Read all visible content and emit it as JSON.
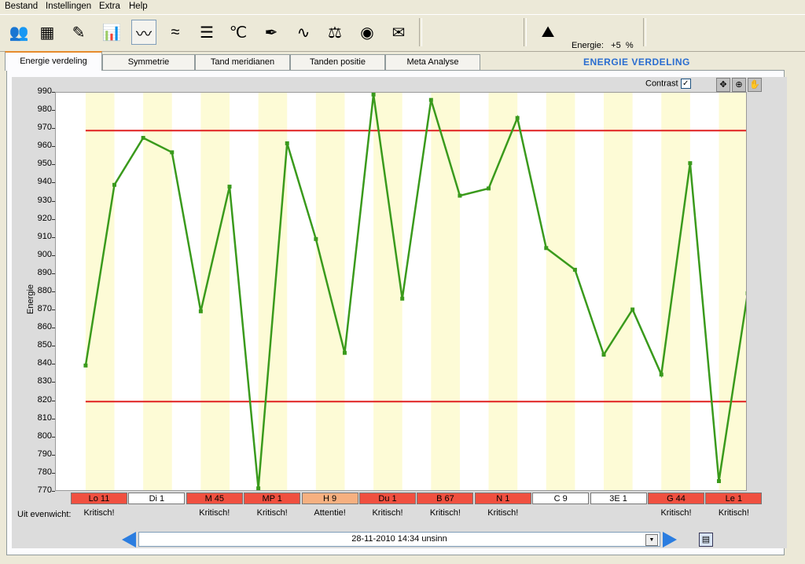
{
  "menu": [
    "Bestand",
    "Instellingen",
    "Extra",
    "Help"
  ],
  "toolbar": {
    "icons": [
      "users-icon",
      "table-icon",
      "ruler-icon",
      "bar-chart-icon",
      "line-chart-icon",
      "multi-line-icon",
      "bars-eq-icon",
      "temperature-icon",
      "needle-icon",
      "wave-icon",
      "scale-icon",
      "dial-icon",
      "envelope-icon"
    ],
    "energie_label": "Energie:",
    "energie_value": "+5",
    "energie_unit": "%"
  },
  "tabs": [
    "Energie verdeling",
    "Symmetrie",
    "Tand meridianen",
    "Tanden positie",
    "Meta Analyse"
  ],
  "section_title": "ENERGIE VERDELING",
  "contrast_label": "Contrast",
  "contrast_checked": "✓",
  "outside_label": "Uit evenwicht:",
  "nav_value": "28-11-2010 14:34  unsinn",
  "chart_data": {
    "type": "line",
    "ylabel": "Energie",
    "ylim": [
      770,
      990
    ],
    "ytick_step": 10,
    "upper_limit": 969,
    "lower_limit": 819,
    "values": [
      839,
      939,
      965,
      957,
      869,
      938,
      771,
      962,
      909,
      846,
      989,
      876,
      986,
      933,
      937,
      976,
      904,
      892,
      845,
      870,
      834,
      951,
      775,
      879
    ],
    "groups": [
      {
        "label": "Lo 11",
        "status": "Kritisch!",
        "color": "#f05040"
      },
      {
        "label": "Di 1",
        "status": "",
        "color": "#ffffff"
      },
      {
        "label": "M 45",
        "status": "Kritisch!",
        "color": "#f05040"
      },
      {
        "label": "MP 1",
        "status": "Kritisch!",
        "color": "#f05040"
      },
      {
        "label": "H 9",
        "status": "Attentie!",
        "color": "#f6b080"
      },
      {
        "label": "Du 1",
        "status": "Kritisch!",
        "color": "#f05040"
      },
      {
        "label": "B 67",
        "status": "Kritisch!",
        "color": "#f05040"
      },
      {
        "label": "N 1",
        "status": "Kritisch!",
        "color": "#f05040"
      },
      {
        "label": "C 9",
        "status": "",
        "color": "#ffffff"
      },
      {
        "label": "3E 1",
        "status": "",
        "color": "#ffffff"
      },
      {
        "label": "G 44",
        "status": "Kritisch!",
        "color": "#f05040"
      },
      {
        "label": "Le 1",
        "status": "Kritisch!",
        "color": "#f05040"
      }
    ],
    "line_color": "#3a9a1c",
    "limit_color": "#e02020",
    "band_color": "#fdfbd6"
  }
}
